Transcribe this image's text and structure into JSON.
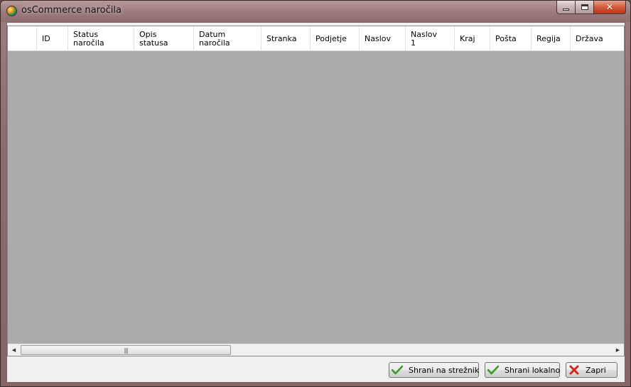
{
  "window": {
    "title": "osCommerce naročila",
    "controls": {
      "minimize": "minimize-icon",
      "maximize": "maximize-icon",
      "close": "close-icon"
    }
  },
  "grid": {
    "columns": [
      {
        "key": "id",
        "line1": "ID",
        "line2": ""
      },
      {
        "key": "status",
        "line1": "Status",
        "line2": "naročila"
      },
      {
        "key": "opis",
        "line1": "Opis",
        "line2": "statusa"
      },
      {
        "key": "datum",
        "line1": "Datum",
        "line2": "naročila"
      },
      {
        "key": "stranka",
        "line1": "Stranka",
        "line2": ""
      },
      {
        "key": "podjetje",
        "line1": "Podjetje",
        "line2": ""
      },
      {
        "key": "naslov",
        "line1": "Naslov",
        "line2": ""
      },
      {
        "key": "naslov1",
        "line1": "Naslov",
        "line2": "1"
      },
      {
        "key": "kraj",
        "line1": "Kraj",
        "line2": ""
      },
      {
        "key": "posta",
        "line1": "Pošta",
        "line2": ""
      },
      {
        "key": "regija",
        "line1": "Regija",
        "line2": ""
      },
      {
        "key": "drzava",
        "line1": "Država",
        "line2": ""
      }
    ],
    "rows": []
  },
  "buttons": {
    "save_server": "Shrani na strežnik",
    "save_local": "Shrani lokalno",
    "close": "Zapri"
  },
  "colors": {
    "grid_background": "#ababab",
    "confirm_icon": "#3c9a28",
    "cancel_icon": "#d4261c"
  }
}
